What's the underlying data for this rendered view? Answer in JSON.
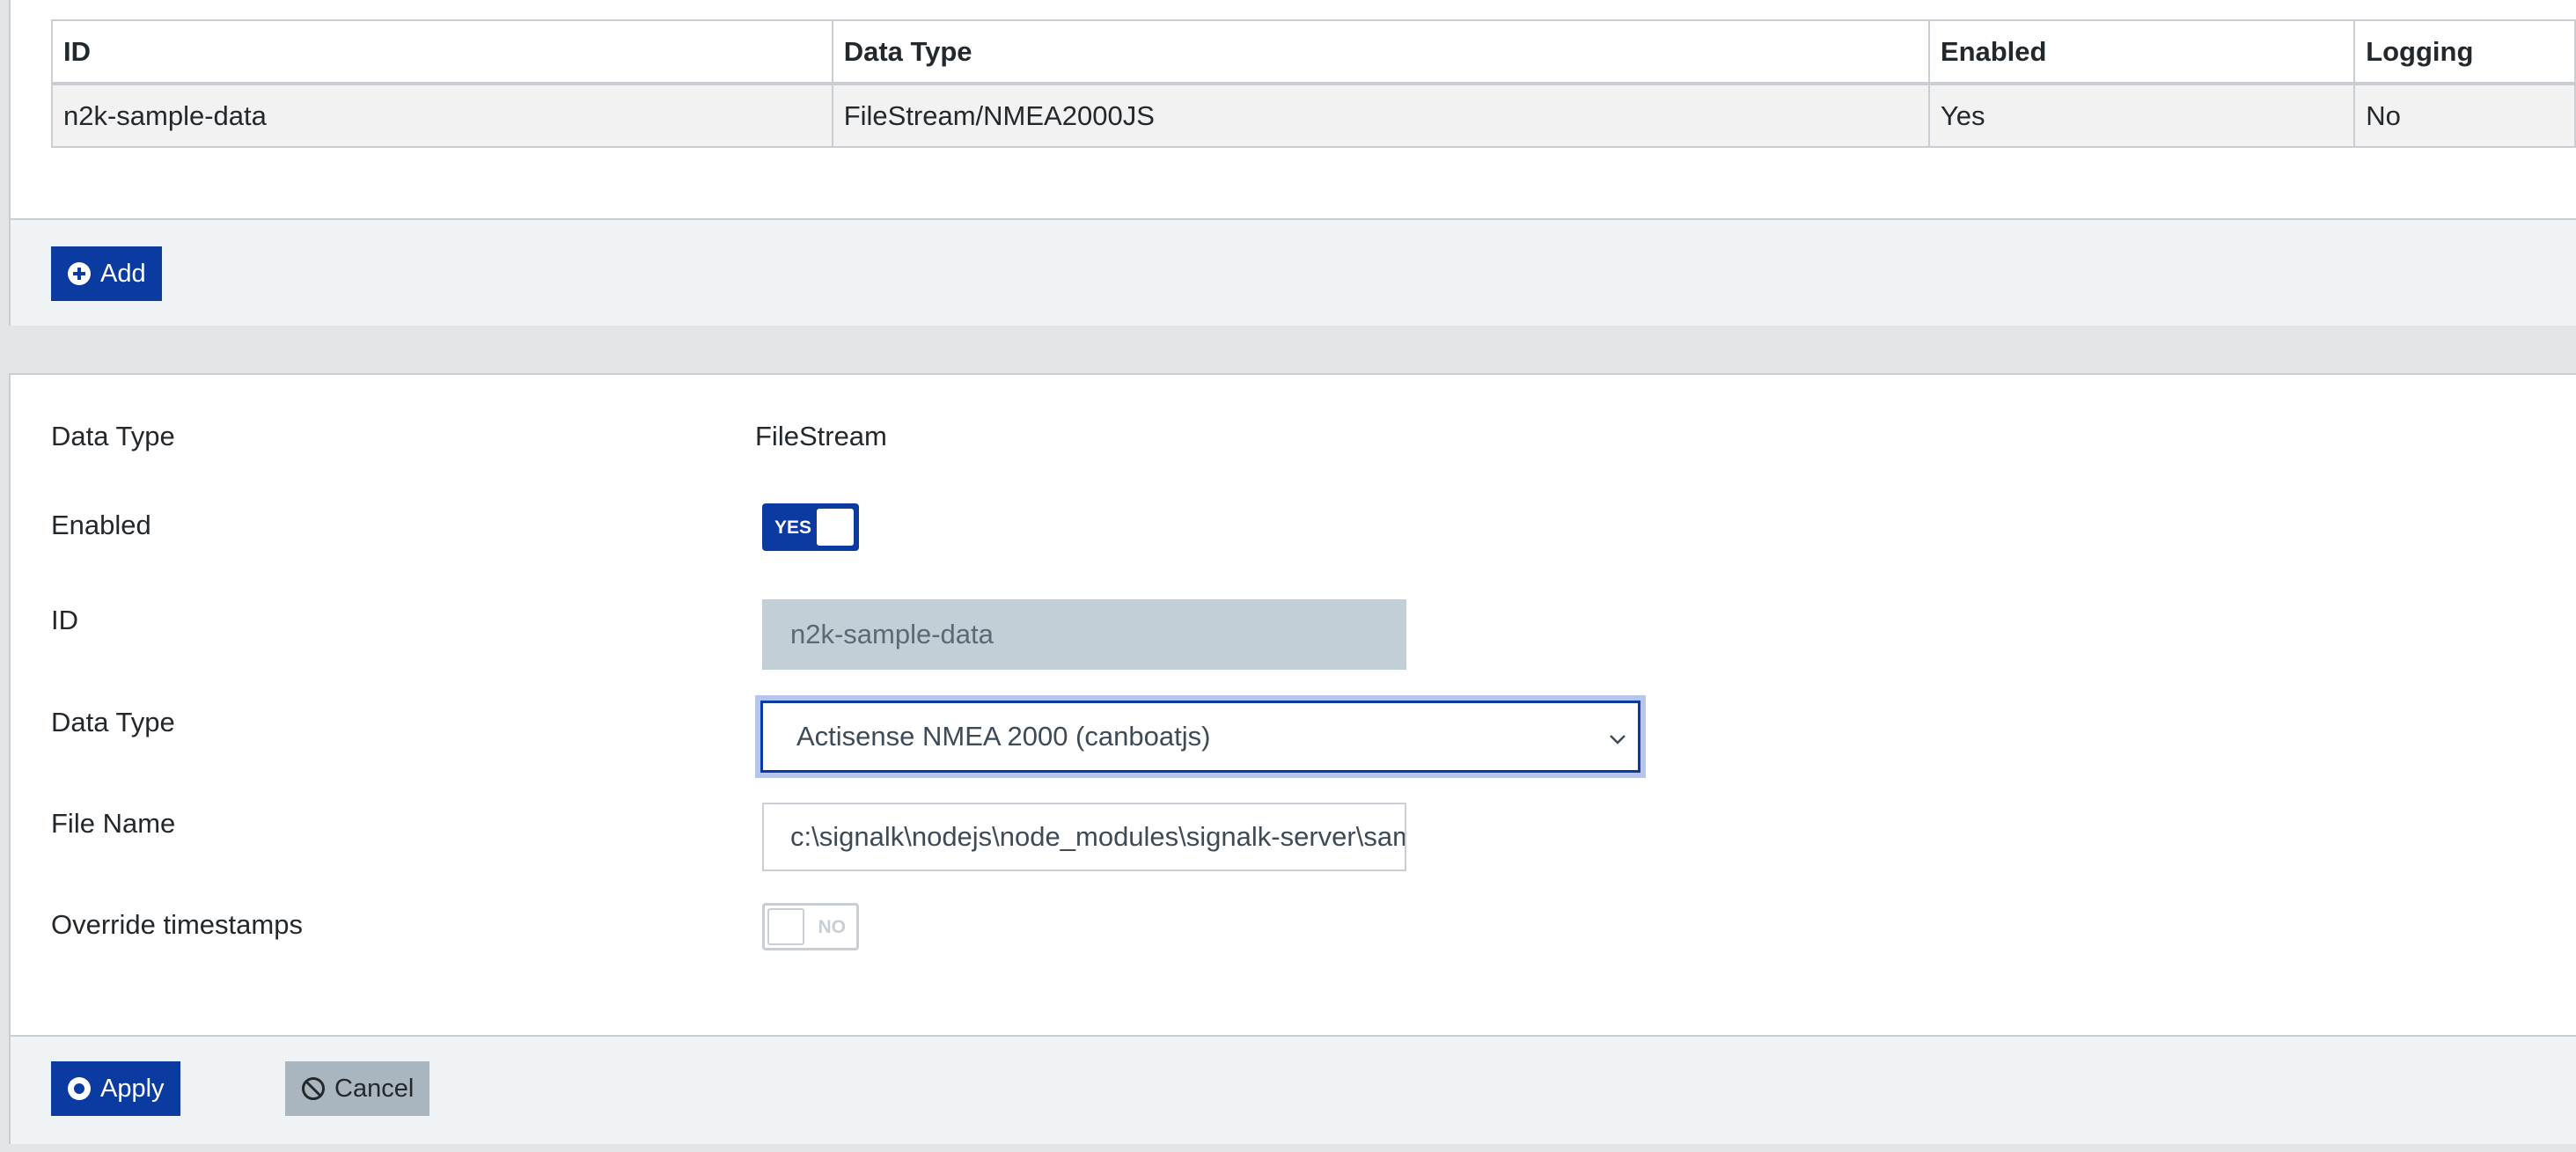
{
  "connections_table": {
    "headers": [
      "ID",
      "Data Type",
      "Enabled",
      "Logging"
    ],
    "rows": [
      {
        "id": "n2k-sample-data",
        "data_type": "FileStream/NMEA2000JS",
        "enabled": "Yes",
        "logging": "No"
      }
    ]
  },
  "add_button": {
    "label": "Add",
    "icon": "plus-circle-icon"
  },
  "form": {
    "data_type_label": "Data Type",
    "data_type_value": "FileStream",
    "enabled_label": "Enabled",
    "enabled_switch_text": "YES",
    "enabled_value": true,
    "id_label": "ID",
    "id_value": "n2k-sample-data",
    "sub_data_type_label": "Data Type",
    "sub_data_type_selected": "Actisense NMEA 2000 (canboatjs)",
    "file_name_label": "File Name",
    "file_name_value": "c:\\signalk\\nodejs\\node_modules\\signalk-server\\samples",
    "override_timestamps_label": "Override timestamps",
    "override_switch_text": "NO",
    "override_value": false
  },
  "footer": {
    "apply_label": "Apply",
    "apply_icon": "dot-circle-icon",
    "cancel_label": "Cancel",
    "cancel_icon": "ban-icon"
  },
  "colors": {
    "primary": "#0b3aa0",
    "focus_ring": "#b6c5ee",
    "secondary": "#aab6bf",
    "border": "#c8ced3"
  }
}
